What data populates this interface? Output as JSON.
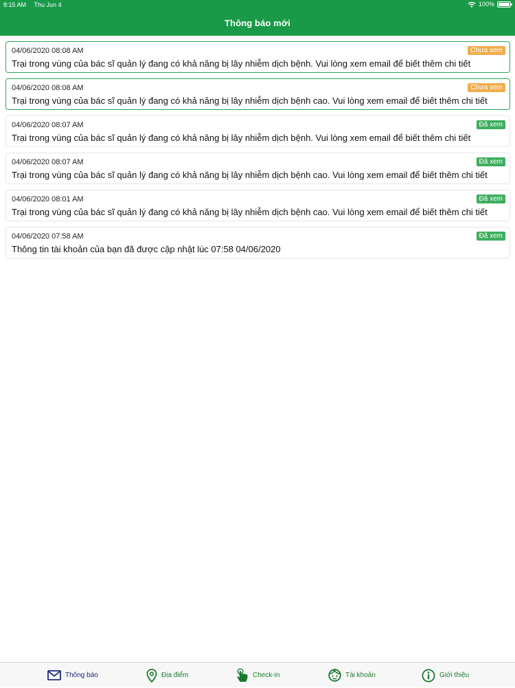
{
  "status_bar": {
    "time": "8:15 AM",
    "date": "Thu Jun 4",
    "battery": "100%",
    "wifi_icon": "wifi-icon"
  },
  "header": {
    "title": "Thông báo mới"
  },
  "notifications": [
    {
      "time": "04/06/2020 08:08 AM",
      "message": "Trại trong vùng của bác sĩ quản lý đang có khả năng bị lây nhiễm dịch bệnh. Vui lòng xem email để biết thêm chi tiết",
      "status": "Chưa xem",
      "read": false
    },
    {
      "time": "04/06/2020 08:08 AM",
      "message": "Trại trong vùng của bác sĩ quản lý đang có khả năng bị lây nhiễm dịch bệnh cao. Vui lòng xem email để biết thêm chi tiết",
      "status": "Chưa xem",
      "read": false
    },
    {
      "time": "04/06/2020 08:07 AM",
      "message": "Trại trong vùng của bác sĩ quản lý đang có khả năng bị lây nhiễm dịch bệnh. Vui lòng xem email để biết thêm chi tiết",
      "status": "Đã xem",
      "read": true
    },
    {
      "time": "04/06/2020 08:07 AM",
      "message": "Trại trong vùng của bác sĩ quản lý đang có khả năng bị lây nhiễm dịch bệnh cao. Vui lòng xem email để biết thêm chi tiết",
      "status": "Đã xem",
      "read": true
    },
    {
      "time": "04/06/2020 08:01 AM",
      "message": "Trại trong vùng của bác sĩ quản lý đang có khả năng bị lây nhiễm dịch bệnh cao. Vui lòng xem email để biết thêm chi tiết",
      "status": "Đã xem",
      "read": true
    },
    {
      "time": "04/06/2020 07:58 AM",
      "message": "Thông tin tài khoản của bạn đã được cập nhật lúc 07:58 04/06/2020",
      "status": "Đã xem",
      "read": true
    }
  ],
  "tabbar": {
    "tabs": [
      {
        "label": "Thông báo",
        "icon": "envelope-icon",
        "active": true
      },
      {
        "label": "Địa điểm",
        "icon": "map-pin-icon",
        "active": false
      },
      {
        "label": "Check-in",
        "icon": "hand-pointer-icon",
        "active": false
      },
      {
        "label": "Tài khoản",
        "icon": "user-face-icon",
        "active": false
      },
      {
        "label": "Giới thiệu",
        "icon": "info-icon",
        "active": false
      }
    ]
  },
  "colors": {
    "header": "#1a9a49",
    "unread_badge": "#f0ad4e",
    "read_badge": "#3cae5e",
    "unread_border": "#2aa55a",
    "tab_active": "#1b2a7d",
    "tab_icon": "#1a7a2e"
  }
}
